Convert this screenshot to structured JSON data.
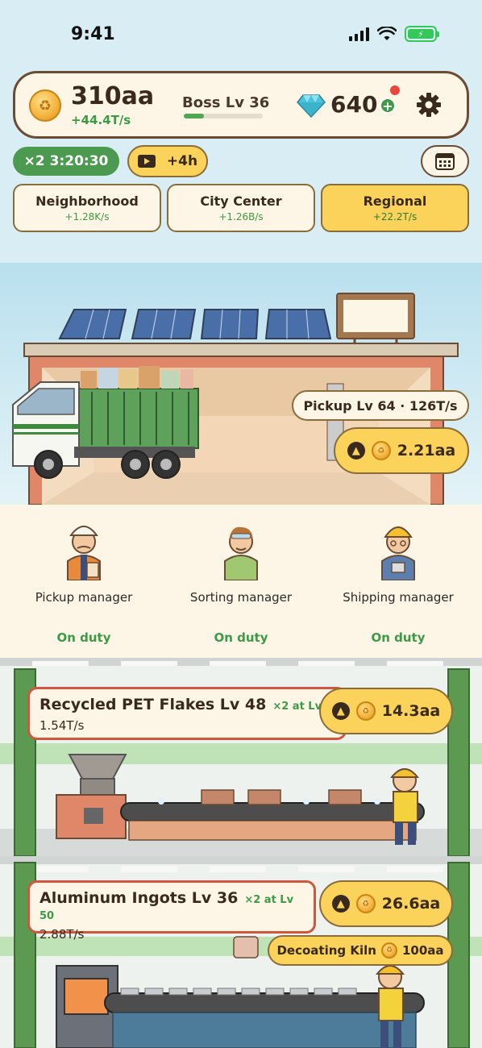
{
  "status_bar": {
    "time": "9:41"
  },
  "header": {
    "coin_balance": "310aa",
    "coin_rate": "+44.4T/s",
    "boss_label": "Boss Lv 36",
    "boss_progress": 0.25,
    "gems": "640",
    "gem_plus": "+"
  },
  "boost": {
    "label": "×2 3:20:30"
  },
  "ad_boost": {
    "label": "+4h"
  },
  "regions": [
    {
      "name": "Neighborhood",
      "rate": "+1.28K/s",
      "active": false
    },
    {
      "name": "City Center",
      "rate": "+1.26B/s",
      "active": false
    },
    {
      "name": "Regional",
      "rate": "+22.2T/s",
      "active": true
    }
  ],
  "pickup": {
    "label": "Pickup Lv 64 · 126T/s",
    "upgrade_cost": "2.21aa"
  },
  "managers": [
    {
      "name": "Pickup manager",
      "status": "On duty"
    },
    {
      "name": "Sorting manager",
      "status": "On duty"
    },
    {
      "name": "Shipping manager",
      "status": "On duty"
    }
  ],
  "lines": [
    {
      "name": "Recycled PET Flakes  Lv 48",
      "bonus": "×2 at Lv",
      "rate": "1.54T/s",
      "upgrade_cost": "14.3aa"
    },
    {
      "name": "Aluminum Ingots  Lv 36",
      "bonus": "×2 at Lv 50",
      "rate": "2.88T/s",
      "upgrade_cost": "26.6aa",
      "machine": {
        "name": "Decoating Kiln",
        "cost": "100aa"
      }
    }
  ],
  "colors": {
    "accent_yellow": "#fbd25a",
    "green": "#3d9a46",
    "border_brown": "#8a6c3a",
    "line_border_red": "#d0563d"
  }
}
